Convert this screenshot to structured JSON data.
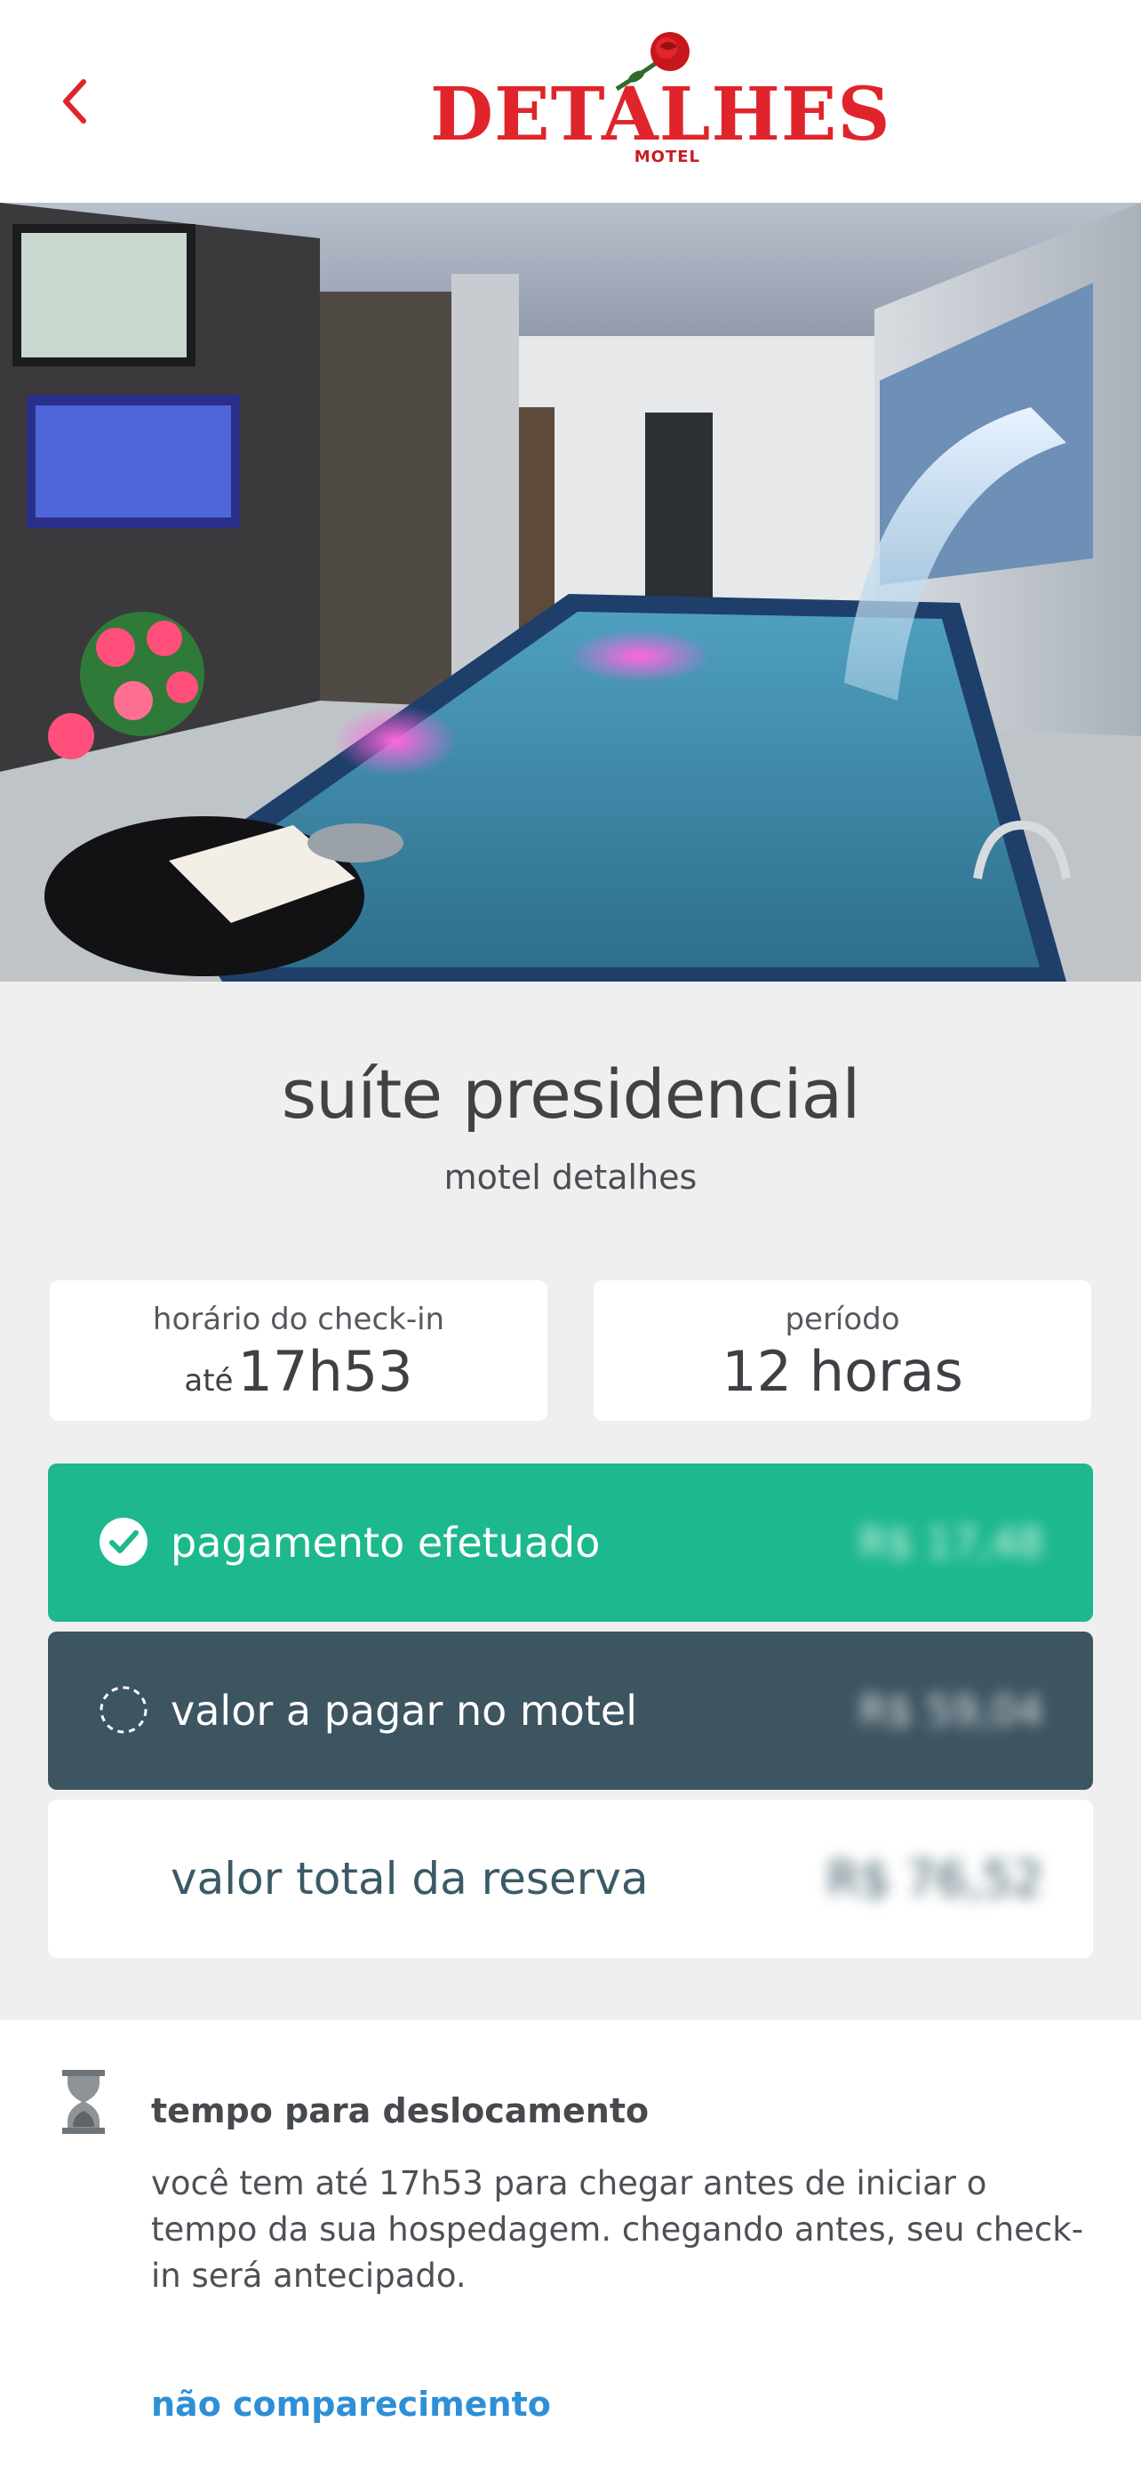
{
  "header": {
    "back_icon": "chevron-left-icon",
    "logo": {
      "word": "DETALHES",
      "sub": "MOTEL",
      "brand_color": "#e0242b"
    }
  },
  "hero": {
    "alt": "suite photo"
  },
  "suite": {
    "title": "suíte presidencial",
    "motel": "motel detalhes"
  },
  "checkin": {
    "label": "horário do check-in",
    "prefix": "até",
    "value": "17h53"
  },
  "period": {
    "label": "período",
    "value": "12 horas"
  },
  "payments": {
    "paid": {
      "label": "pagamento efetuado",
      "amount": "R$ 17,48",
      "icon": "check-circle-icon",
      "color": "#1db88d"
    },
    "due": {
      "label": "valor a pagar no motel",
      "amount": "R$ 59,04",
      "icon": "dashed-circle-icon",
      "color": "#3d5561"
    },
    "total": {
      "label": "valor total da reserva",
      "amount": "R$ 76,52"
    }
  },
  "travel": {
    "icon": "hourglass-icon",
    "title": "tempo para deslocamento",
    "text": "você tem até 17h53 para chegar antes de iniciar o tempo da sua hospedagem. chegando antes, seu check-in será antecipado.",
    "link": "não comparecimento",
    "link_color": "#2e8fd6"
  }
}
